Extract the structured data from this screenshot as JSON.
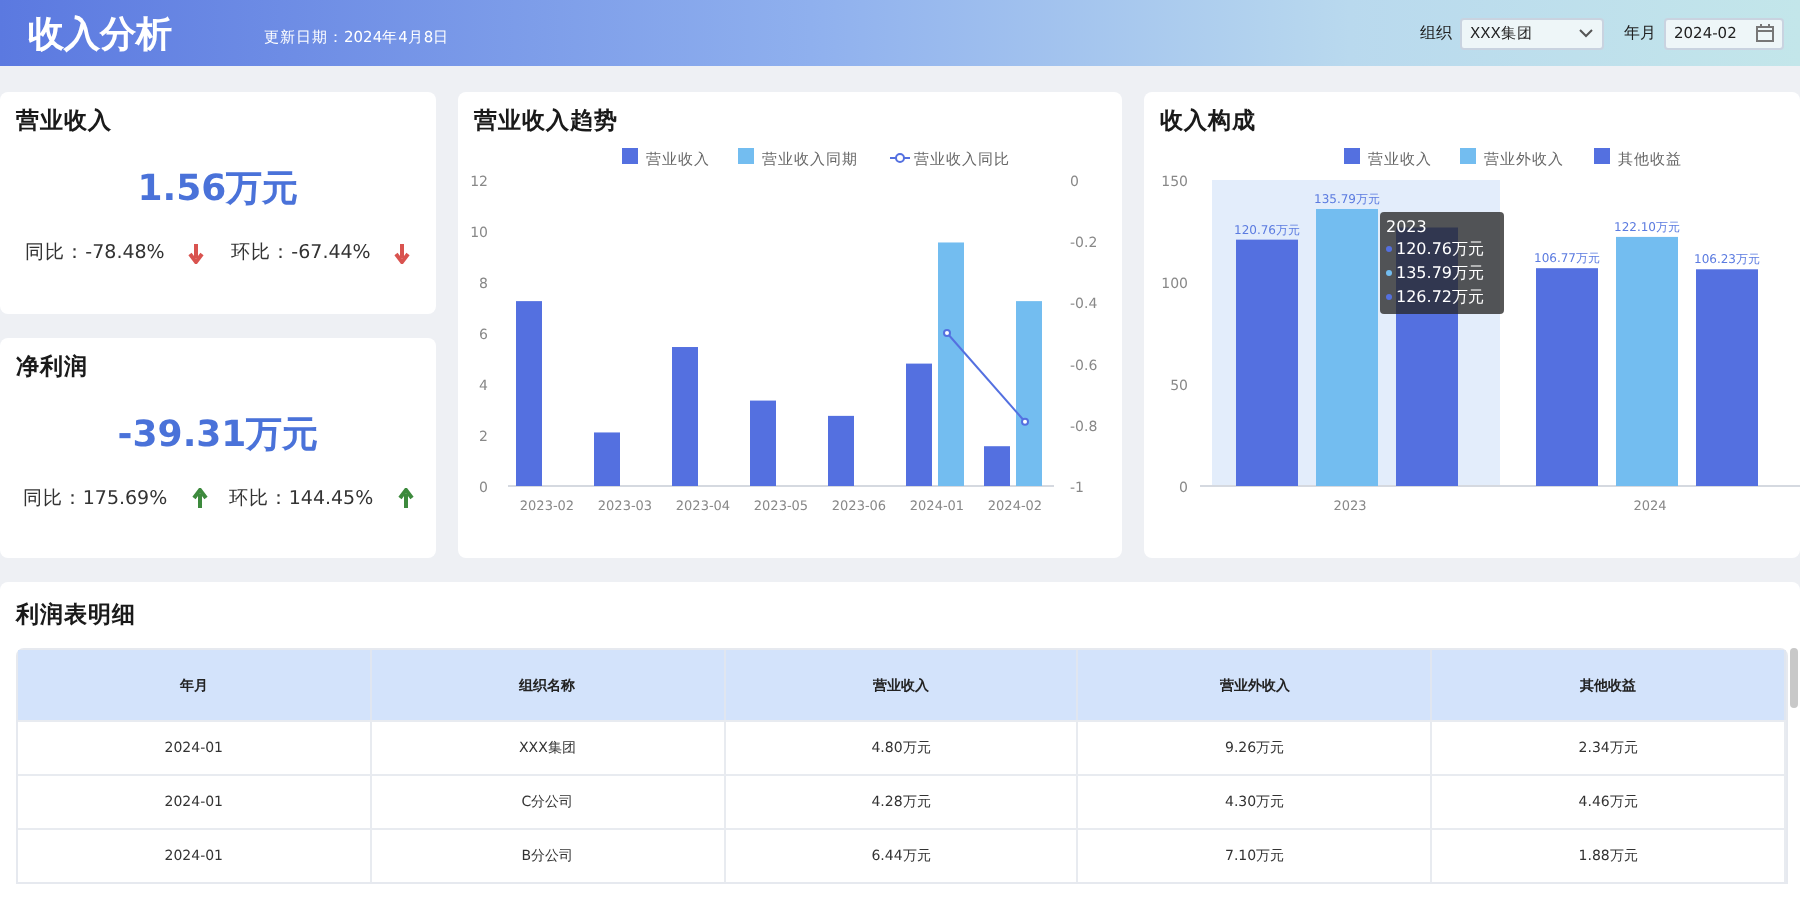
{
  "header": {
    "title": "收入分析",
    "update": "更新日期：2024年4月8日",
    "filters": [
      {
        "kind": "select",
        "label": "组织",
        "value": "XXX集团"
      },
      {
        "kind": "date",
        "label": "年月",
        "value": "2024-02"
      }
    ]
  },
  "kpis": [
    {
      "title": "营业收入",
      "value": "1.56万元",
      "compare": [
        {
          "text": "同比：-78.48%",
          "rising": false
        },
        {
          "text": "环比：-67.44%",
          "rising": false
        }
      ]
    },
    {
      "title": "净利润",
      "value": "-39.31万元",
      "compare": [
        {
          "text": "同比：175.69%",
          "rising": true
        },
        {
          "text": "环比：144.45%",
          "rising": true
        }
      ]
    }
  ],
  "trend": {
    "title": "营业收入趋势",
    "chart_data": {
      "type": "bar",
      "categories": [
        "2023-02",
        "2023-03",
        "2023-04",
        "2023-05",
        "2023-06",
        "2024-01",
        "2024-02"
      ],
      "legend": "top",
      "ylim": [
        0,
        12
      ],
      "yticks": [
        0,
        2,
        4,
        6,
        8,
        10,
        12
      ],
      "series": [
        {
          "name": "营业收入",
          "color": "#5470e0",
          "values": [
            7.25,
            2.1,
            5.45,
            3.35,
            2.75,
            4.8,
            1.56
          ]
        },
        {
          "name": "营业收入同期",
          "color": "#73bdf0",
          "values": [
            null,
            null,
            null,
            null,
            null,
            9.55,
            7.25
          ]
        }
      ]
    },
    "ratio_chart": {
      "chart_data": {
        "type": "line",
        "legend": "top",
        "ylim": [
          -1,
          0
        ],
        "yticks": [
          0,
          -0.2,
          -0.4,
          -0.6,
          -0.8,
          -1
        ],
        "series": [
          {
            "name": "营业收入同比",
            "color": "#5470e0",
            "marker": "circle",
            "values": [
              null,
              null,
              null,
              null,
              null,
              -0.5,
              -0.79
            ]
          }
        ]
      }
    }
  },
  "composition": {
    "title": "收入构成",
    "chart_data": {
      "type": "bar",
      "categories": [
        "2023",
        "2024"
      ],
      "legend": "top",
      "ylim": [
        0,
        150
      ],
      "yticks": [
        0,
        50,
        100,
        150
      ],
      "value_labels": [
        [
          "120.76万元",
          "106.77万元"
        ],
        [
          "135.79万元",
          "122.10万元"
        ],
        [
          null,
          "106.23万元"
        ]
      ],
      "series": [
        {
          "name": "营业收入",
          "color": "#5470e0",
          "values": [
            120.76,
            106.77
          ]
        },
        {
          "name": "营业外收入",
          "color": "#73bdf0",
          "values": [
            135.79,
            122.1
          ]
        },
        {
          "name": "其他收益",
          "color": "#5470e0",
          "values": [
            126.72,
            106.23
          ]
        }
      ]
    },
    "tooltip": {
      "title": "2023",
      "items": [
        "120.76万元",
        "135.79万元",
        "126.72万元"
      ]
    }
  },
  "table": {
    "title": "利润表明细",
    "columns": [
      "年月",
      "组织名称",
      "营业收入",
      "营业外收入",
      "其他收益"
    ],
    "rows": [
      [
        "2024-01",
        "XXX集团",
        "4.80万元",
        "9.26万元",
        "2.34万元"
      ],
      [
        "2024-01",
        "C分公司",
        "4.28万元",
        "4.30万元",
        "4.46万元"
      ],
      [
        "2024-01",
        "B分公司",
        "6.44万元",
        "7.10万元",
        "1.88万元"
      ]
    ]
  }
}
